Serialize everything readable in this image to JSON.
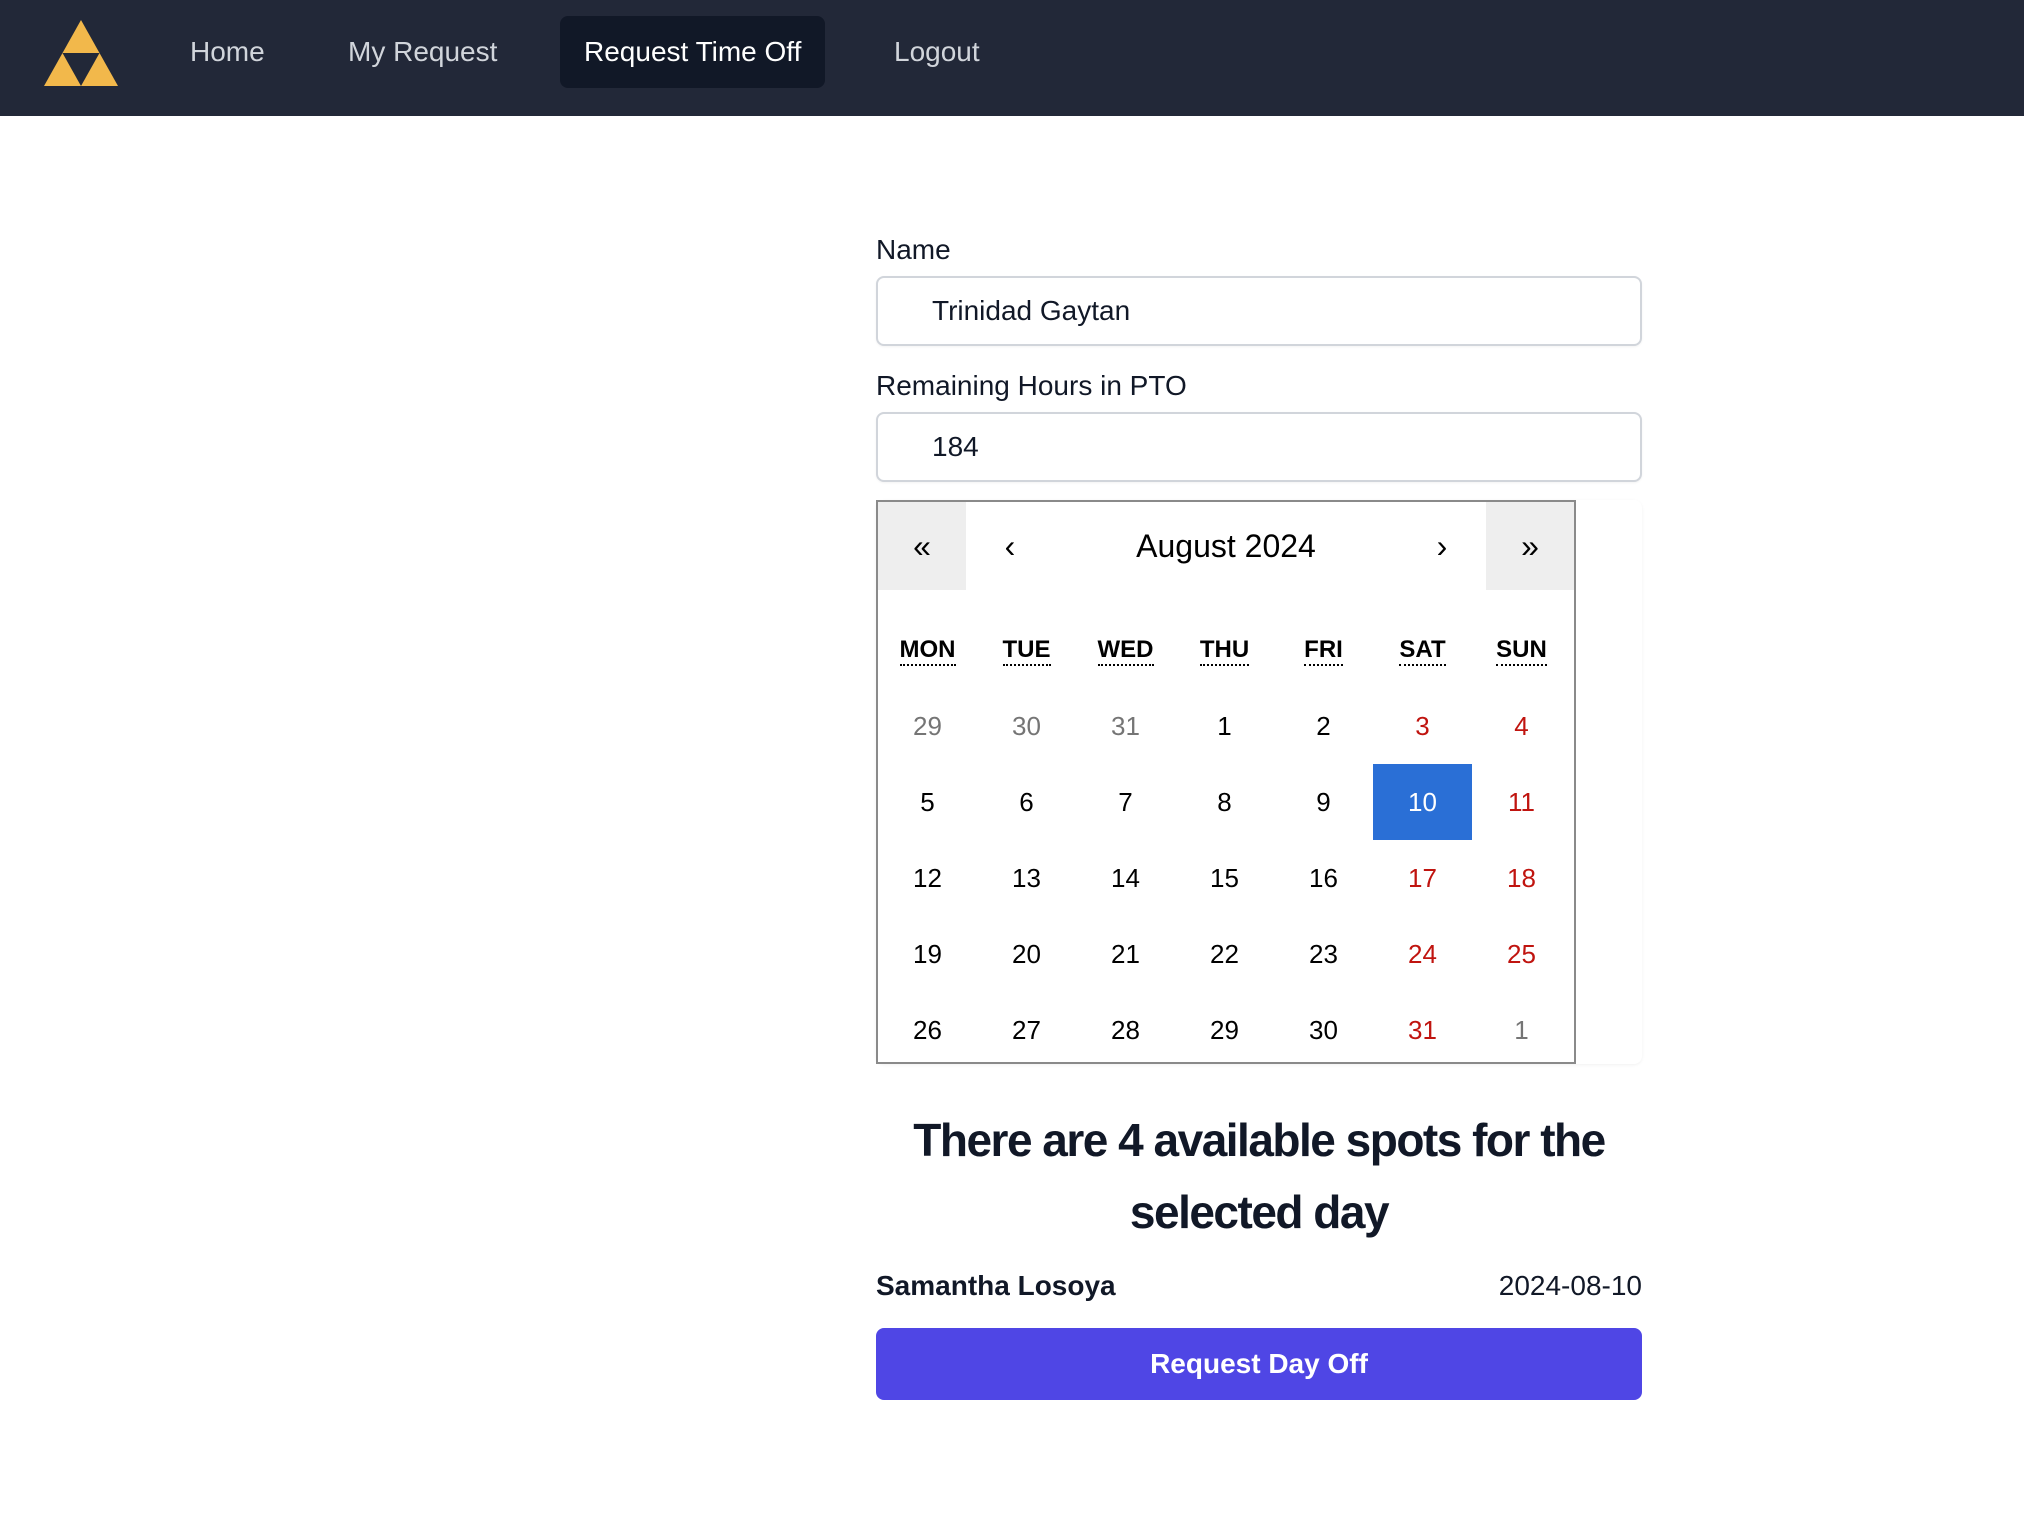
{
  "nav": {
    "logo_icon": "triforce-logo-icon",
    "items": [
      {
        "label": "Home"
      },
      {
        "label": "My Request"
      },
      {
        "label": "Request Time Off"
      },
      {
        "label": "Logout"
      }
    ],
    "active_item": "Request Time Off"
  },
  "form": {
    "name_label": "Name",
    "name_value": "Trinidad Gaytan",
    "pto_label": "Remaining Hours in PTO",
    "pto_value": "184"
  },
  "calendar": {
    "prev_year_label": "«",
    "prev_month_label": "‹",
    "month_label": "August 2024",
    "next_month_label": "›",
    "next_year_label": "»",
    "weekdays": [
      "MON",
      "TUE",
      "WED",
      "THU",
      "FRI",
      "SAT",
      "SUN"
    ],
    "weeks": [
      [
        "29",
        "30",
        "31",
        "1",
        "2",
        "3",
        "4"
      ],
      [
        "5",
        "6",
        "7",
        "8",
        "9",
        "10",
        "11"
      ],
      [
        "12",
        "13",
        "14",
        "15",
        "16",
        "17",
        "18"
      ],
      [
        "19",
        "20",
        "21",
        "22",
        "23",
        "24",
        "25"
      ],
      [
        "26",
        "27",
        "28",
        "29",
        "30",
        "31",
        "1"
      ]
    ],
    "selected_day": "10",
    "colors": {
      "weekend": "#c0140f",
      "neighbor_month": "#757575",
      "selected_bg": "#2a6fd6",
      "nav_button_bg": "#eeeeee"
    }
  },
  "availability": {
    "title": "There are 4 available spots for the selected day",
    "entries": [
      {
        "name": "Samantha Losoya",
        "date": "2024-08-10"
      }
    ]
  },
  "actions": {
    "request_label": "Request Day Off",
    "request_color": "#4f46e5"
  }
}
